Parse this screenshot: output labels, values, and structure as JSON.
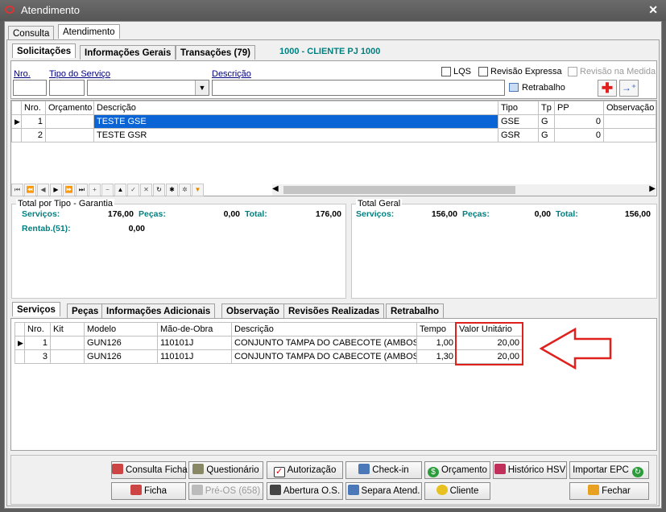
{
  "window": {
    "title": "Atendimento",
    "close": "✕"
  },
  "top_tabs": [
    "Consulta",
    "Atendimento"
  ],
  "sub_tabs": [
    "Solicitações",
    "Informações Gerais",
    "Transações (79)"
  ],
  "client_header": "1000 - CLIENTE PJ 1000",
  "filters": {
    "nro_label": "Nro.",
    "tipo_label": "Tipo do Serviço",
    "descricao_label": "Descrição",
    "lqs": "LQS",
    "revisao_expressa": "Revisão Expressa",
    "revisao_medida": "Revisão na Medida",
    "retrabalho": "Retrabalho"
  },
  "sol_columns": [
    "Nro.",
    "Orçamento",
    "Descrição",
    "Tipo",
    "Tp",
    "PP",
    "Observação"
  ],
  "sol_rows": [
    {
      "nro": "1",
      "orcamento": "",
      "descricao": "TESTE GSE",
      "tipo": "GSE",
      "tp": "G",
      "pp": "0",
      "obs": ""
    },
    {
      "nro": "2",
      "orcamento": "",
      "descricao": "TESTE GSR",
      "tipo": "GSR",
      "tp": "G",
      "pp": "0",
      "obs": ""
    }
  ],
  "totals_left": {
    "title": "Total por Tipo - Garantia",
    "servicos_label": "Serviços:",
    "servicos": "176,00",
    "pecas_label": "Peças:",
    "pecas": "0,00",
    "total_label": "Total:",
    "total": "176,00",
    "rentab_label": "Rentab.(51):",
    "rentab": "0,00"
  },
  "totals_right": {
    "title": "Total Geral",
    "servicos_label": "Serviços:",
    "servicos": "156,00",
    "pecas_label": "Peças:",
    "pecas": "0,00",
    "total_label": "Total:",
    "total": "156,00"
  },
  "bottom_tabs": [
    "Serviços",
    "Peças",
    "Informações Adicionais",
    "Observação",
    "Revisões Realizadas",
    "Retrabalho"
  ],
  "serv_columns": [
    "Nro.",
    "Kit",
    "Modelo",
    "Mão-de-Obra",
    "Descrição",
    "Tempo",
    "Valor Unitário"
  ],
  "serv_rows": [
    {
      "nro": "1",
      "kit": "",
      "modelo": "GUN126",
      "mao": "110101J",
      "descricao": "CONJUNTO TAMPA DO CABECOTE (AMBOS O",
      "tempo": "1,00",
      "valor": "20,00"
    },
    {
      "nro": "3",
      "kit": "",
      "modelo": "GUN126",
      "mao": "110101J",
      "descricao": "CONJUNTO TAMPA DO CABECOTE (AMBOS O",
      "tempo": "1,30",
      "valor": "20,00"
    }
  ],
  "buttons": {
    "consulta_ficha": "Consulta Ficha",
    "questionario": "Questionário",
    "autorizacao": "Autorização",
    "checkin": "Check-in",
    "orcamento": "Orçamento",
    "historico": "Histórico HSV",
    "importar": "Importar EPC",
    "ficha": "Ficha",
    "preos": "Pré-OS (658)",
    "abertura": "Abertura O.S.",
    "separa": "Separa Atend.",
    "cliente": "Cliente",
    "fechar": "Fechar"
  },
  "colors": {
    "selection": "#0a64d6",
    "highlight": "#e0201c",
    "header_teal": "#008080"
  }
}
